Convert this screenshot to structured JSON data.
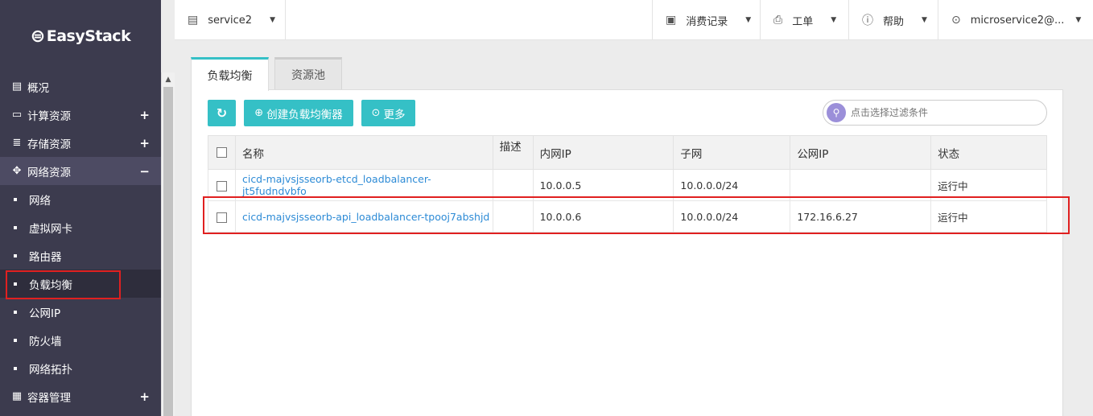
{
  "brand": {
    "logo_text": "EasyStack"
  },
  "sidebar": {
    "items": [
      {
        "label": "概况",
        "icon": "clipboard-icon"
      },
      {
        "label": "计算资源",
        "icon": "monitor-icon"
      },
      {
        "label": "存储资源",
        "icon": "database-icon"
      },
      {
        "label": "网络资源",
        "icon": "network-icon"
      }
    ],
    "network_sub": [
      {
        "label": "网络"
      },
      {
        "label": "虚拟网卡"
      },
      {
        "label": "路由器"
      },
      {
        "label": "负载均衡"
      },
      {
        "label": "公网IP"
      },
      {
        "label": "防火墙"
      },
      {
        "label": "网络拓扑"
      }
    ],
    "container": {
      "label": "容器管理"
    },
    "expand_symbol": "+",
    "collapse_symbol": "−"
  },
  "topbar": {
    "project": "service2",
    "billing": "消费记录",
    "tickets": "工单",
    "help": "帮助",
    "user": "microservice2@..."
  },
  "tabs": {
    "active": "负载均衡",
    "inactive": "资源池"
  },
  "toolbar": {
    "create_label": "创建负载均衡器",
    "more_label": "更多",
    "search_placeholder": "点击选择过滤条件"
  },
  "table": {
    "headers": {
      "name": "名称",
      "desc": "描述",
      "private_ip": "内网IP",
      "subnet": "子网",
      "public_ip": "公网IP",
      "status": "状态"
    },
    "rows": [
      {
        "name": "cicd-majvsjsseorb-etcd_loadbalancer-jt5fudndvbfo",
        "desc": "",
        "private_ip": "10.0.0.5",
        "subnet": "10.0.0.0/24",
        "public_ip": "",
        "status": "运行中"
      },
      {
        "name": "cicd-majvsjsseorb-api_loadbalancer-tpooj7abshjd",
        "desc": "",
        "private_ip": "10.0.0.6",
        "subnet": "10.0.0.0/24",
        "public_ip": "172.16.6.27",
        "status": "运行中"
      }
    ]
  },
  "colors": {
    "accent": "#35c0c6",
    "sidebar_bg": "#3c3b4e",
    "link": "#2d8bd6",
    "highlight": "#e02020"
  }
}
